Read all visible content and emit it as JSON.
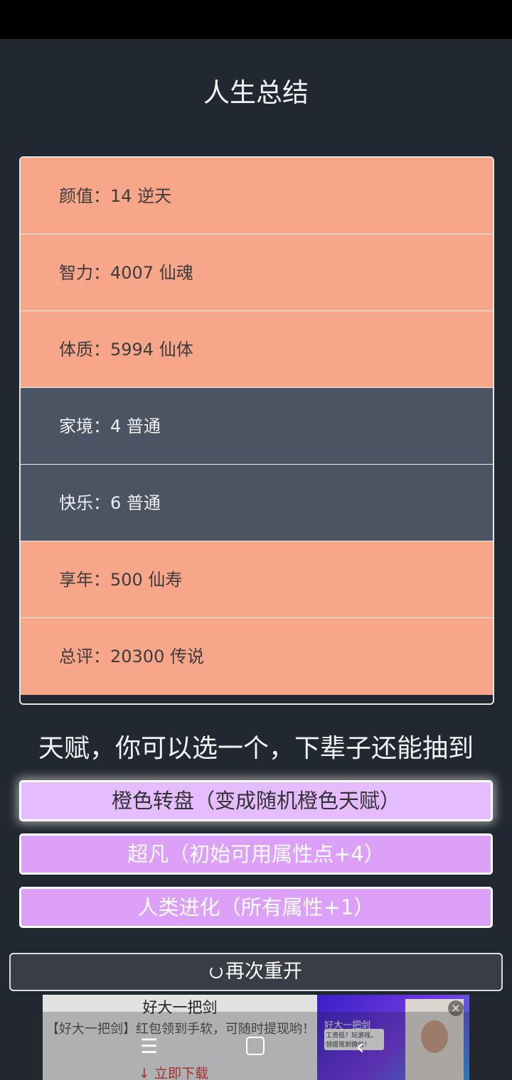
{
  "page": {
    "title": "人生总结"
  },
  "summary": [
    {
      "label": "颜值：14 逆天",
      "level": "orange"
    },
    {
      "label": "智力：4007 仙魂",
      "level": "orange"
    },
    {
      "label": "体质：5994 仙体",
      "level": "orange"
    },
    {
      "label": "家境：4 普通",
      "level": "grey"
    },
    {
      "label": "快乐：6 普通",
      "level": "grey"
    },
    {
      "label": "享年：500 仙寿",
      "level": "orange"
    },
    {
      "label": "总评：20300 传说",
      "level": "orange"
    }
  ],
  "talents": {
    "title": "天赋，你可以选一个，下辈子还能抽到",
    "options": [
      {
        "label": "橙色转盘（变成随机橙色天赋）",
        "selected": true
      },
      {
        "label": "超凡（初始可用属性点+4）",
        "selected": false
      },
      {
        "label": "人类进化（所有属性+1）",
        "selected": false
      }
    ]
  },
  "restart": {
    "label": "再次重开"
  },
  "ad": {
    "title": "好大一把剑",
    "description": "【好大一把剑】红包领到手软，可随时提现哟！",
    "download": "立即下载",
    "brand": "好大一把剑",
    "bubble_text": "工资低？玩游戏，领提现到微信！"
  },
  "colors": {
    "orange": "#f7a68a",
    "grey": "#4b5463",
    "talent": "#dda0f8",
    "background": "#222831"
  }
}
